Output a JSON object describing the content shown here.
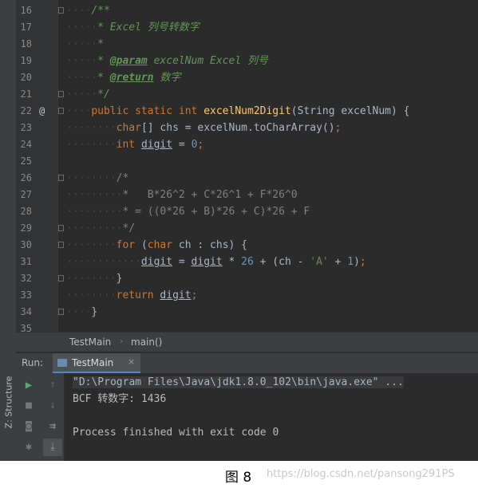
{
  "editor": {
    "lines": [
      {
        "n": "16",
        "mark": "",
        "fold": true,
        "segments": [
          {
            "t": "····",
            "c": "dots"
          },
          {
            "t": "/**",
            "c": "c-doc"
          }
        ]
      },
      {
        "n": "17",
        "mark": "",
        "fold": false,
        "segments": [
          {
            "t": "·····",
            "c": "dots"
          },
          {
            "t": "* Excel 列号转数字",
            "c": "c-doc"
          }
        ]
      },
      {
        "n": "18",
        "mark": "",
        "fold": false,
        "segments": [
          {
            "t": "·····",
            "c": "dots"
          },
          {
            "t": "*",
            "c": "c-doc"
          }
        ]
      },
      {
        "n": "19",
        "mark": "",
        "fold": false,
        "segments": [
          {
            "t": "·····",
            "c": "dots"
          },
          {
            "t": "* ",
            "c": "c-doc"
          },
          {
            "t": "@param",
            "c": "c-tag"
          },
          {
            "t": " excelNum Excel 列号",
            "c": "c-doc"
          }
        ]
      },
      {
        "n": "20",
        "mark": "",
        "fold": false,
        "segments": [
          {
            "t": "·····",
            "c": "dots"
          },
          {
            "t": "* ",
            "c": "c-doc"
          },
          {
            "t": "@return",
            "c": "c-tag"
          },
          {
            "t": " 数字",
            "c": "c-doc"
          }
        ]
      },
      {
        "n": "21",
        "mark": "",
        "fold": true,
        "segments": [
          {
            "t": "·····",
            "c": "dots"
          },
          {
            "t": "*/",
            "c": "c-doc"
          }
        ]
      },
      {
        "n": "22",
        "mark": "@",
        "fold": true,
        "segments": [
          {
            "t": "····",
            "c": "dots"
          },
          {
            "t": "public static int ",
            "c": "c-kw"
          },
          {
            "t": "excelNum2Digit",
            "c": "c-fn"
          },
          {
            "t": "(String excelNum) {",
            "c": ""
          }
        ]
      },
      {
        "n": "23",
        "mark": "",
        "fold": false,
        "segments": [
          {
            "t": "········",
            "c": "dots"
          },
          {
            "t": "char",
            "c": "c-kw"
          },
          {
            "t": "[] chs = excelNum.toCharArray()",
            "c": ""
          },
          {
            "t": ";",
            "c": "c-kw"
          }
        ]
      },
      {
        "n": "24",
        "mark": "",
        "fold": false,
        "segments": [
          {
            "t": "········",
            "c": "dots"
          },
          {
            "t": "int ",
            "c": "c-kw"
          },
          {
            "t": "digit",
            "c": "c-ul"
          },
          {
            "t": " = ",
            "c": ""
          },
          {
            "t": "0",
            "c": "c-num"
          },
          {
            "t": ";",
            "c": "c-kw"
          }
        ]
      },
      {
        "n": "25",
        "mark": "",
        "fold": false,
        "segments": []
      },
      {
        "n": "26",
        "mark": "",
        "fold": true,
        "segments": [
          {
            "t": "········",
            "c": "dots"
          },
          {
            "t": "/*",
            "c": "c-cmt"
          }
        ]
      },
      {
        "n": "27",
        "mark": "",
        "fold": false,
        "segments": [
          {
            "t": "·········",
            "c": "dots"
          },
          {
            "t": "*   B*26^2 + C*26^1 + F*26^0",
            "c": "c-cmt"
          }
        ]
      },
      {
        "n": "28",
        "mark": "",
        "fold": false,
        "segments": [
          {
            "t": "·········",
            "c": "dots"
          },
          {
            "t": "* = ((0*26 + B)*26 + C)*26 + F",
            "c": "c-cmt"
          }
        ]
      },
      {
        "n": "29",
        "mark": "",
        "fold": true,
        "segments": [
          {
            "t": "·········",
            "c": "dots"
          },
          {
            "t": "*/",
            "c": "c-cmt"
          }
        ]
      },
      {
        "n": "30",
        "mark": "",
        "fold": true,
        "segments": [
          {
            "t": "········",
            "c": "dots"
          },
          {
            "t": "for ",
            "c": "c-kw"
          },
          {
            "t": "(",
            "c": ""
          },
          {
            "t": "char ",
            "c": "c-kw"
          },
          {
            "t": "ch : chs) {",
            "c": ""
          }
        ]
      },
      {
        "n": "31",
        "mark": "",
        "fold": false,
        "segments": [
          {
            "t": "············",
            "c": "dots"
          },
          {
            "t": "digit",
            "c": "c-ul"
          },
          {
            "t": " = ",
            "c": ""
          },
          {
            "t": "digit",
            "c": "c-ul"
          },
          {
            "t": " * ",
            "c": ""
          },
          {
            "t": "26",
            "c": "c-num"
          },
          {
            "t": " + (ch - ",
            "c": ""
          },
          {
            "t": "'A'",
            "c": "c-str"
          },
          {
            "t": " + ",
            "c": ""
          },
          {
            "t": "1",
            "c": "c-num"
          },
          {
            "t": ")",
            "c": ""
          },
          {
            "t": ";",
            "c": "c-kw"
          }
        ]
      },
      {
        "n": "32",
        "mark": "",
        "fold": true,
        "segments": [
          {
            "t": "········",
            "c": "dots"
          },
          {
            "t": "}",
            "c": ""
          }
        ]
      },
      {
        "n": "33",
        "mark": "",
        "fold": false,
        "segments": [
          {
            "t": "········",
            "c": "dots"
          },
          {
            "t": "return ",
            "c": "c-kw"
          },
          {
            "t": "digit",
            "c": "c-ul"
          },
          {
            "t": ";",
            "c": "c-kw"
          }
        ]
      },
      {
        "n": "34",
        "mark": "",
        "fold": true,
        "segments": [
          {
            "t": "····",
            "c": "dots"
          },
          {
            "t": "}",
            "c": ""
          }
        ]
      },
      {
        "n": "35",
        "mark": "",
        "fold": false,
        "segments": []
      }
    ]
  },
  "breadcrumb": {
    "class_name": "TestMain",
    "separator": "›",
    "method_name": "main()"
  },
  "run_panel": {
    "label": "Run:",
    "tab_label": "TestMain",
    "tab_close": "×"
  },
  "sidebar": {
    "structure_label": "Z: Structure"
  },
  "console": {
    "command": "\"D:\\Program Files\\Java\\jdk1.8.0_102\\bin\\java.exe\" ...",
    "output": "BCF 转数字: 1436",
    "exit": "Process finished with exit code 0"
  },
  "figure": {
    "caption": "图 8",
    "watermark": "https://blog.csdn.net/pansong291PS"
  },
  "colors": {
    "editor_bg": "#2b2b2b",
    "panel_bg": "#3c3f41",
    "keyword": "#cc7832",
    "doc_comment": "#629755",
    "number": "#6897bb",
    "method": "#ffc66d"
  }
}
